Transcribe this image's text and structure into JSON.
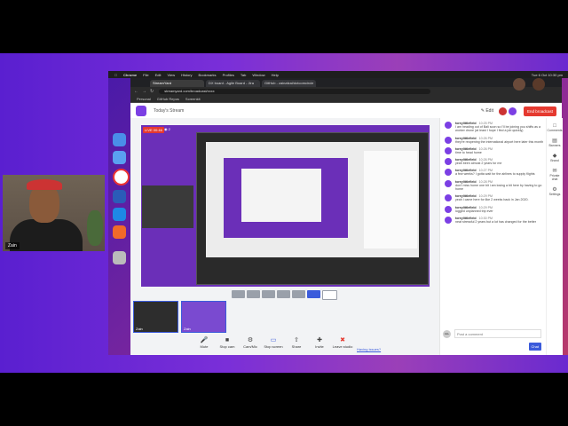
{
  "mac_menu": {
    "app": "Chrome",
    "items": [
      "File",
      "Edit",
      "View",
      "History",
      "Bookmarks",
      "Profiles",
      "Tab",
      "Window",
      "Help"
    ],
    "clock": "Tue 6 Oct 10:30 pm"
  },
  "browser": {
    "tabs": [
      "StreamYard",
      "DX board - Agile Board - Jira",
      "GitHub - zainafzal/dotcomcircle"
    ],
    "url": "streamyard.com/broadcast/xxxx",
    "bookmarks": [
      "Personal",
      "GitHub Repos",
      "Screenkit"
    ]
  },
  "app": {
    "stream_name": "Today's Stream",
    "edit_label": "Edit",
    "end_label": "End broadcast",
    "live_badge": "LIVE 00:46",
    "viewers": "◉ 2"
  },
  "tiles": [
    {
      "name": "Zain",
      "kind": "cam"
    },
    {
      "name": "Zain",
      "kind": "screen"
    }
  ],
  "toolbar": [
    {
      "label": "Mute",
      "icon": "mic-icon"
    },
    {
      "label": "Stop cam",
      "icon": "camera-icon"
    },
    {
      "label": "Cam/Mic",
      "icon": "gear-icon"
    },
    {
      "label": "Stop screen",
      "icon": "screen-icon"
    },
    {
      "label": "Share",
      "icon": "share-icon"
    },
    {
      "label": "Invite",
      "icon": "invite-icon"
    },
    {
      "label": "Leave studio",
      "icon": "leave-icon"
    }
  ],
  "issues_link": "Having issues?",
  "chat": {
    "messages": [
      {
        "name": "toreylittlefield",
        "time": "10:25 PM",
        "text": "I am heading out of Bali soon so I'll be joining you shifts as a worker drone (at least I hope I find a job quickly)"
      },
      {
        "name": "toreylittlefield",
        "time": "10:26 PM",
        "text": "they're reopening the international airport here later this month"
      },
      {
        "name": "toreylittlefield",
        "time": "10:26 PM",
        "text": "time to head home"
      },
      {
        "name": "toreylittlefield",
        "time": "10:26 PM",
        "text": "yeah been almost 2 years for me"
      },
      {
        "name": "toreylittlefield",
        "time": "10:27 PM",
        "text": "a few weeks? I gotta wait for the airlines to supply flights"
      },
      {
        "name": "toreylittlefield",
        "time": "10:28 PM",
        "text": "don't miss home one bit i am losing a bit here by having to go home"
      },
      {
        "name": "toreylittlefield",
        "time": "10:29 PM",
        "text": "yeah i came here for like 2 weeks back in Jan 2020."
      },
      {
        "name": "toreylittlefield",
        "time": "10:29 PM",
        "text": "logged unplanned trip ever"
      },
      {
        "name": "toreylittlefield",
        "time": "10:30 PM",
        "text": "neat stressful 2 years but a lot has changed for the better"
      }
    ],
    "all_label": "ALL",
    "placeholder": "Post a comment",
    "send_label": "Chat"
  },
  "side_panel": [
    {
      "label": "Comments",
      "icon": "comments-icon"
    },
    {
      "label": "Banners",
      "icon": "banner-icon"
    },
    {
      "label": "Brand",
      "icon": "brand-icon"
    },
    {
      "label": "Private chat",
      "icon": "private-chat-icon"
    },
    {
      "label": "Settings",
      "icon": "gear-icon"
    }
  ],
  "webcam": {
    "name": "Zain"
  },
  "colors": {
    "accent": "#3b5bdb",
    "danger": "#e5392f",
    "brand": "#7b3fe4"
  }
}
